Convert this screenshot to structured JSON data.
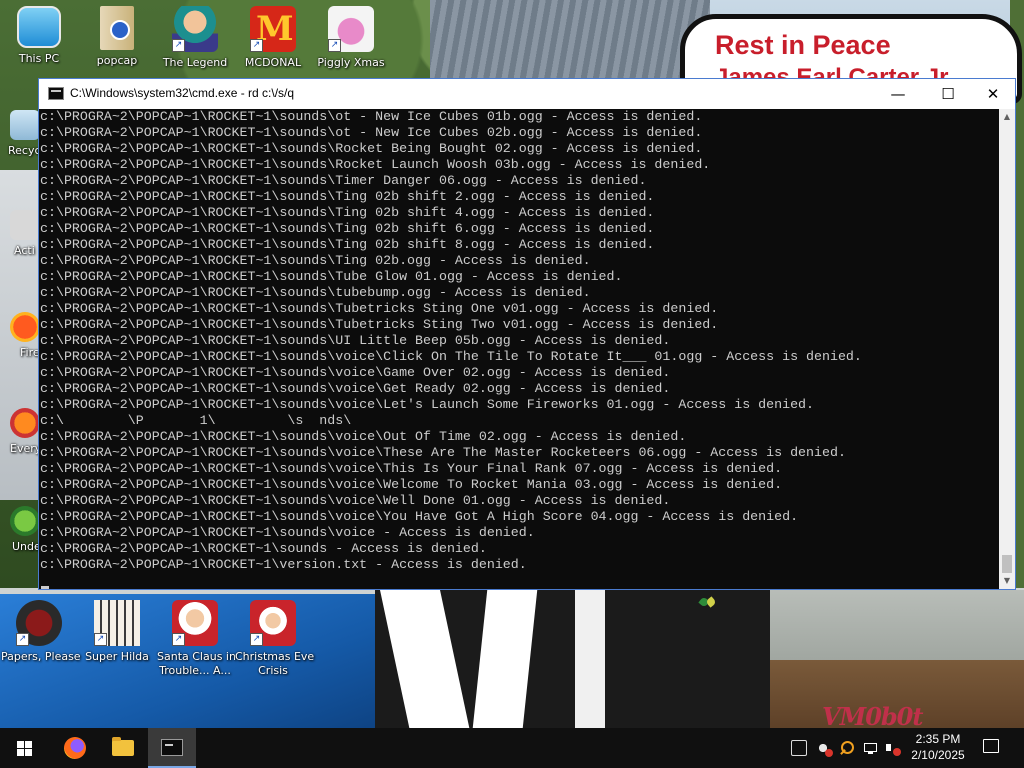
{
  "desktop": {
    "sign_text": "Rest in Peace",
    "sign_text_2": "James Earl Carter Jr.",
    "watermark": "VM0b0t",
    "top_icons": [
      {
        "label": "This PC",
        "icon": "computer-icon"
      },
      {
        "label": "popcap",
        "icon": "folder-icon"
      },
      {
        "label": "The Legend",
        "icon": "game-character-icon"
      },
      {
        "label": "MCDONAL",
        "icon": "mcdonalds-icon"
      },
      {
        "label": "Piggly Xmas",
        "icon": "pig-icon"
      }
    ],
    "left_partial_icons": [
      {
        "label": "Recyc",
        "icon": "recycle-bin-icon"
      },
      {
        "label": "Acti",
        "icon": "app-icon"
      },
      {
        "label": "Fire",
        "icon": "firefox-icon"
      },
      {
        "label": "Every",
        "icon": "app-icon"
      },
      {
        "label": "Unde",
        "icon": "app-icon"
      }
    ],
    "bottom_icons": [
      {
        "label": "Papers, Please",
        "label2": "",
        "icon": "papers-please-icon"
      },
      {
        "label": "Super Hilda",
        "label2": "",
        "icon": "super-hilda-icon"
      },
      {
        "label": "Santa Claus in",
        "label2": "Trouble... A...",
        "icon": "santa-claus-icon"
      },
      {
        "label": "Christmas Eve",
        "label2": "Crisis",
        "icon": "santa-claus-icon"
      }
    ]
  },
  "cmd_window": {
    "title": "C:\\Windows\\system32\\cmd.exe - rd  c:\\/s/q",
    "minimize": "—",
    "maximize": "☐",
    "close": "✕",
    "lines": [
      "c:\\PROGRA~2\\POPCAP~1\\ROCKET~1\\sounds\\ot - New Ice Cubes 01b.ogg - Access is denied.",
      "c:\\PROGRA~2\\POPCAP~1\\ROCKET~1\\sounds\\ot - New Ice Cubes 02b.ogg - Access is denied.",
      "c:\\PROGRA~2\\POPCAP~1\\ROCKET~1\\sounds\\Rocket Being Bought 02.ogg - Access is denied.",
      "c:\\PROGRA~2\\POPCAP~1\\ROCKET~1\\sounds\\Rocket Launch Woosh 03b.ogg - Access is denied.",
      "c:\\PROGRA~2\\POPCAP~1\\ROCKET~1\\sounds\\Timer Danger 06.ogg - Access is denied.",
      "c:\\PROGRA~2\\POPCAP~1\\ROCKET~1\\sounds\\Ting 02b shift 2.ogg - Access is denied.",
      "c:\\PROGRA~2\\POPCAP~1\\ROCKET~1\\sounds\\Ting 02b shift 4.ogg - Access is denied.",
      "c:\\PROGRA~2\\POPCAP~1\\ROCKET~1\\sounds\\Ting 02b shift 6.ogg - Access is denied.",
      "c:\\PROGRA~2\\POPCAP~1\\ROCKET~1\\sounds\\Ting 02b shift 8.ogg - Access is denied.",
      "c:\\PROGRA~2\\POPCAP~1\\ROCKET~1\\sounds\\Ting 02b.ogg - Access is denied.",
      "c:\\PROGRA~2\\POPCAP~1\\ROCKET~1\\sounds\\Tube Glow 01.ogg - Access is denied.",
      "c:\\PROGRA~2\\POPCAP~1\\ROCKET~1\\sounds\\tubebump.ogg - Access is denied.",
      "c:\\PROGRA~2\\POPCAP~1\\ROCKET~1\\sounds\\Tubetricks Sting One v01.ogg - Access is denied.",
      "c:\\PROGRA~2\\POPCAP~1\\ROCKET~1\\sounds\\Tubetricks Sting Two v01.ogg - Access is denied.",
      "c:\\PROGRA~2\\POPCAP~1\\ROCKET~1\\sounds\\UI Little Beep 05b.ogg - Access is denied.",
      "c:\\PROGRA~2\\POPCAP~1\\ROCKET~1\\sounds\\voice\\Click On The Tile To Rotate It___ 01.ogg - Access is denied.",
      "c:\\PROGRA~2\\POPCAP~1\\ROCKET~1\\sounds\\voice\\Game Over 02.ogg - Access is denied.",
      "c:\\PROGRA~2\\POPCAP~1\\ROCKET~1\\sounds\\voice\\Get Ready 02.ogg - Access is denied.",
      "c:\\PROGRA~2\\POPCAP~1\\ROCKET~1\\sounds\\voice\\Let's Launch Some Fireworks 01.ogg - Access is denied.",
      "c:\\        \\P       1\\         \\s  nds\\",
      "c:\\PROGRA~2\\POPCAP~1\\ROCKET~1\\sounds\\voice\\Out Of Time 02.ogg - Access is denied.",
      "c:\\PROGRA~2\\POPCAP~1\\ROCKET~1\\sounds\\voice\\These Are The Master Rocketeers 06.ogg - Access is denied.",
      "c:\\PROGRA~2\\POPCAP~1\\ROCKET~1\\sounds\\voice\\This Is Your Final Rank 07.ogg - Access is denied.",
      "c:\\PROGRA~2\\POPCAP~1\\ROCKET~1\\sounds\\voice\\Welcome To Rocket Mania 03.ogg - Access is denied.",
      "c:\\PROGRA~2\\POPCAP~1\\ROCKET~1\\sounds\\voice\\Well Done 01.ogg - Access is denied.",
      "c:\\PROGRA~2\\POPCAP~1\\ROCKET~1\\sounds\\voice\\You Have Got A High Score 04.ogg - Access is denied.",
      "c:\\PROGRA~2\\POPCAP~1\\ROCKET~1\\sounds\\voice - Access is denied.",
      "c:\\PROGRA~2\\POPCAP~1\\ROCKET~1\\sounds - Access is denied.",
      "c:\\PROGRA~2\\POPCAP~1\\ROCKET~1\\version.txt - Access is denied."
    ]
  },
  "taskbar": {
    "time": "2:35 PM",
    "date": "2/10/2025",
    "pinned": [
      "start-icon",
      "firefox-icon",
      "file-explorer-icon",
      "cmd-icon"
    ],
    "tray_icons": [
      "security-icon",
      "network-alert-icon",
      "search-tray-icon",
      "network-icon",
      "volume-muted-icon"
    ]
  }
}
